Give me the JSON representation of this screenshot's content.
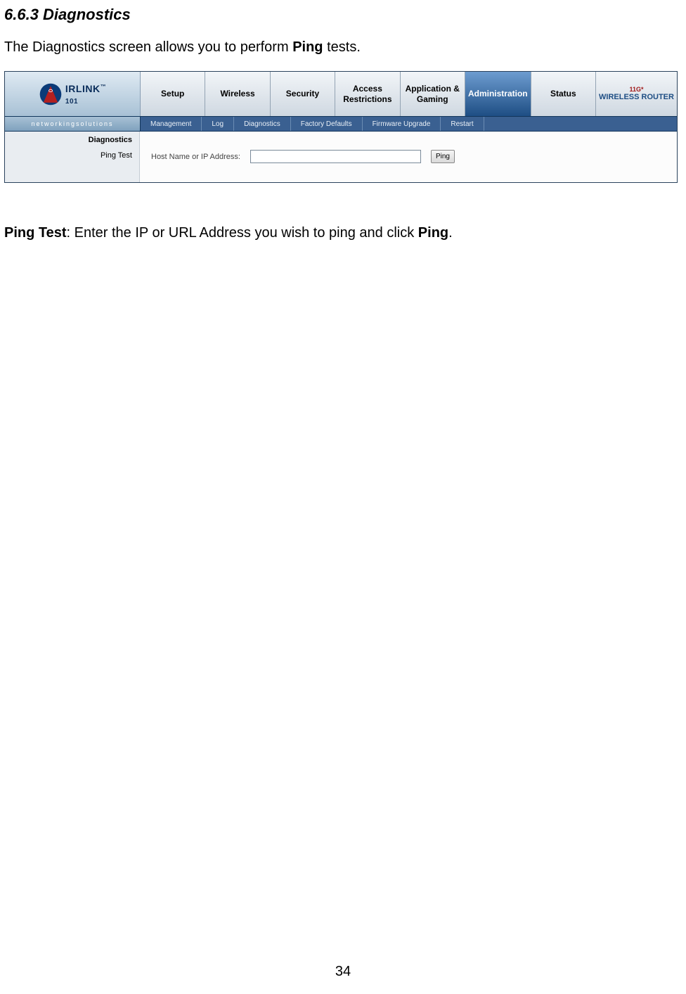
{
  "doc": {
    "section_heading": "6.6.3 Diagnostics",
    "intro_pre": "The Diagnostics screen allows you to perform ",
    "intro_bold": "Ping",
    "intro_post": " tests.",
    "desc_bold1": "Ping Test",
    "desc_mid": ": Enter the IP or URL Address you wish to ping and click ",
    "desc_bold2": "Ping",
    "desc_end": ".",
    "page_number": "34"
  },
  "router": {
    "logo_text": "IRLINK",
    "logo_sub": "101",
    "tagline": "networkingsolutions",
    "brand_small": "11G*",
    "brand_big": "WIRELESS ROUTER",
    "tabs": [
      {
        "label": "Setup"
      },
      {
        "label": "Wireless"
      },
      {
        "label": "Security"
      },
      {
        "label": "Access\nRestrictions"
      },
      {
        "label": "Application &\nGaming"
      },
      {
        "label": "Administration",
        "active": true
      },
      {
        "label": "Status"
      }
    ],
    "subnav": [
      {
        "label": "Management"
      },
      {
        "label": "Log"
      },
      {
        "label": "Diagnostics"
      },
      {
        "label": "Factory Defaults"
      },
      {
        "label": "Firmware Upgrade"
      },
      {
        "label": "Restart"
      }
    ],
    "section_label": "Diagnostics",
    "row_label": "Ping Test",
    "field_label": "Host Name or IP Address:",
    "input_value": "",
    "ping_button": "Ping"
  }
}
